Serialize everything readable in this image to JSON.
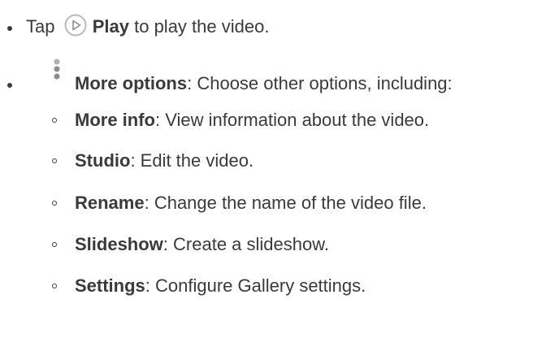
{
  "items": [
    {
      "prefix": "Tap",
      "icon": "play-circle-icon",
      "term": "Play",
      "desc": " to play the video."
    },
    {
      "icon": "more-options-icon",
      "term": "More options",
      "desc": ": Choose other options, including:"
    }
  ],
  "subitems": [
    {
      "term": "More info",
      "desc": ": View information about the video."
    },
    {
      "term": "Studio",
      "desc": ": Edit the video."
    },
    {
      "term": "Rename",
      "desc": ": Change the name of the video file."
    },
    {
      "term": "Slideshow",
      "desc": ": Create a slideshow."
    },
    {
      "term": "Settings",
      "desc": ": Configure Gallery settings."
    }
  ]
}
